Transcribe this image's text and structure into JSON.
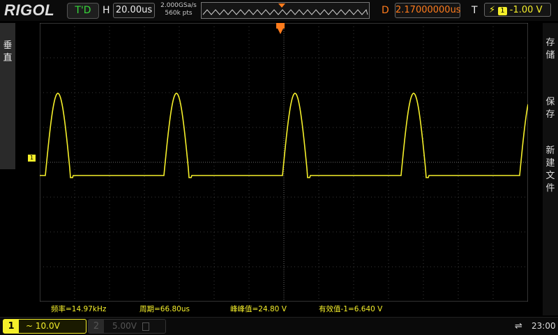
{
  "top": {
    "logo": "RIGOL",
    "run_state": "T'D",
    "timebase_label": "H",
    "timebase": "20.00us",
    "sample_rate": "2.000GSa/s",
    "mem_depth": "560k pts",
    "delay_label": "D",
    "delay": "2.17000000us",
    "trigger_label": "T",
    "trigger_channel": "1",
    "trigger_level": "-1.00 V"
  },
  "left_tab": {
    "label": "垂直"
  },
  "right_menu": {
    "items": [
      "存储",
      "保存",
      "新建文件"
    ]
  },
  "channel_marker": "1",
  "measurements": [
    "频率=14.97kHz",
    "周期=66.80us",
    "峰峰值=24.80 V",
    "有效值-1=6.640 V"
  ],
  "channels": [
    {
      "number": "1",
      "coupling": "~",
      "scale": "10.0V"
    },
    {
      "number": "2",
      "coupling": "",
      "scale": "5.00V"
    }
  ],
  "clock": "23:00",
  "colors": {
    "ch1": "#f5ef2a",
    "trigger": "#ff7b1c",
    "run": "#37d83a"
  }
}
